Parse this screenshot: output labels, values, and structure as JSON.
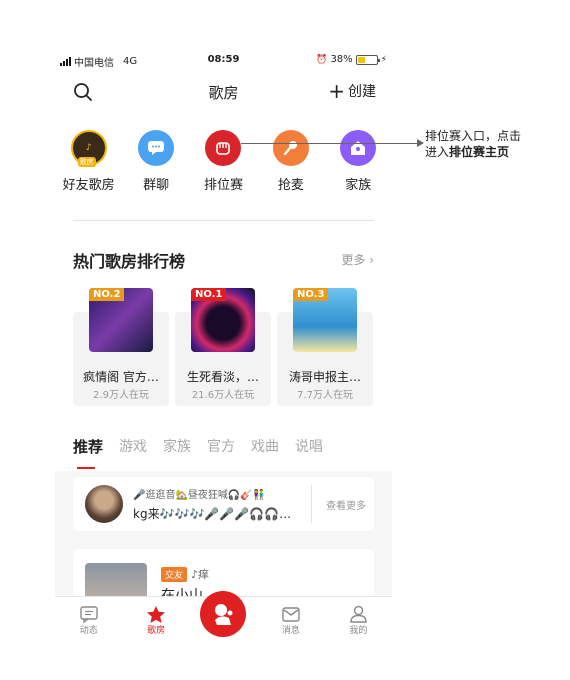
{
  "status_bar": {
    "carrier": "中国电信",
    "network": "4G",
    "time": "08:59",
    "battery": "38%",
    "battery_level": 0.38
  },
  "nav": {
    "title": "歌房",
    "create_label": "创建"
  },
  "categories": [
    {
      "label": "好友歌房",
      "badge": "歌房",
      "icon": "friend-room-avatar",
      "color": "#3a2a1a"
    },
    {
      "label": "群聊",
      "icon": "chat-bubble-icon",
      "color": "#4aa3f0"
    },
    {
      "label": "排位赛",
      "icon": "fist-icon",
      "color": "#d7252b"
    },
    {
      "label": "抢麦",
      "icon": "mic-icon",
      "color": "#f37d3a"
    },
    {
      "label": "家族",
      "icon": "home-icon",
      "color": "#8b5cf6"
    }
  ],
  "hot": {
    "title": "热门歌房排行榜",
    "more": "更多",
    "cards": [
      {
        "rank": "NO.2",
        "name": "疯情阁 官方…",
        "online": "2.9万人在玩",
        "rank_color": "#f0a21f"
      },
      {
        "rank": "NO.1",
        "name": "生死看淡，…",
        "online": "21.6万人在玩",
        "rank_color": "#e02020"
      },
      {
        "rank": "NO.3",
        "name": "涛哥申报主…",
        "online": "7.7万人在玩",
        "rank_color": "#e89a1c"
      }
    ]
  },
  "tabs": [
    "推荐",
    "游戏",
    "家族",
    "官方",
    "戏曲",
    "说唱"
  ],
  "recommend": {
    "line1": "🎤逛逛音🏡昼夜狂喊🎧🎸👫",
    "line2": "kg来🎶🎶🎶🎤🎤🎤🎧🎧…",
    "more": "查看更多"
  },
  "room": {
    "tag": "交友",
    "user": "♪痒",
    "title": "在小山…"
  },
  "tabbar": [
    {
      "label": "动态",
      "icon": "feed-icon"
    },
    {
      "label": "歌房",
      "icon": "star-icon",
      "active": true
    },
    {
      "label": "",
      "icon": "sing-button-icon"
    },
    {
      "label": "消息",
      "icon": "message-icon"
    },
    {
      "label": "我的",
      "icon": "profile-icon"
    }
  ],
  "callout": {
    "line1": "排位赛入口，点击",
    "line2_prefix": "进入",
    "line2_bold": "排位赛主页"
  }
}
